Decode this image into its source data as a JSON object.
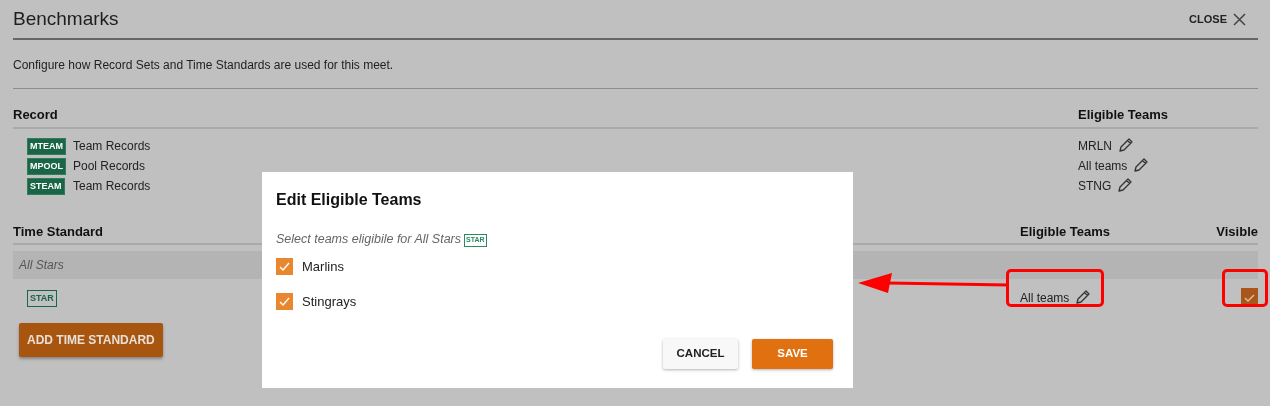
{
  "header": {
    "title": "Benchmarks",
    "close_label": "CLOSE"
  },
  "description": "Configure how Record Sets and Time Standards are used for this meet.",
  "records": {
    "columns": [
      "Record",
      "Eligible Teams"
    ],
    "rows": [
      {
        "code": "MTEAM",
        "name": "Team Records",
        "eligible": "MRLN"
      },
      {
        "code": "MPOOL",
        "name": "Pool Records",
        "eligible": "All teams"
      },
      {
        "code": "STEAM",
        "name": "Team Records",
        "eligible": "STNG"
      }
    ]
  },
  "time_standards": {
    "columns": [
      "Time Standard",
      "Eligible Teams",
      "Visible"
    ],
    "groups": [
      {
        "name": "All Stars",
        "rows": [
          {
            "code": "STAR",
            "eligible": "All teams",
            "visible": true
          }
        ]
      }
    ],
    "add_button": "ADD TIME STANDARD"
  },
  "dialog": {
    "title": "Edit Eligible Teams",
    "prompt": "Select teams eligibile for All Stars",
    "prompt_code": "STAR",
    "teams": [
      {
        "name": "Marlins",
        "checked": true
      },
      {
        "name": "Stingrays",
        "checked": true
      }
    ],
    "buttons": [
      {
        "label": "CANCEL",
        "kind": "secondary"
      },
      {
        "label": "SAVE",
        "kind": "primary"
      }
    ]
  }
}
